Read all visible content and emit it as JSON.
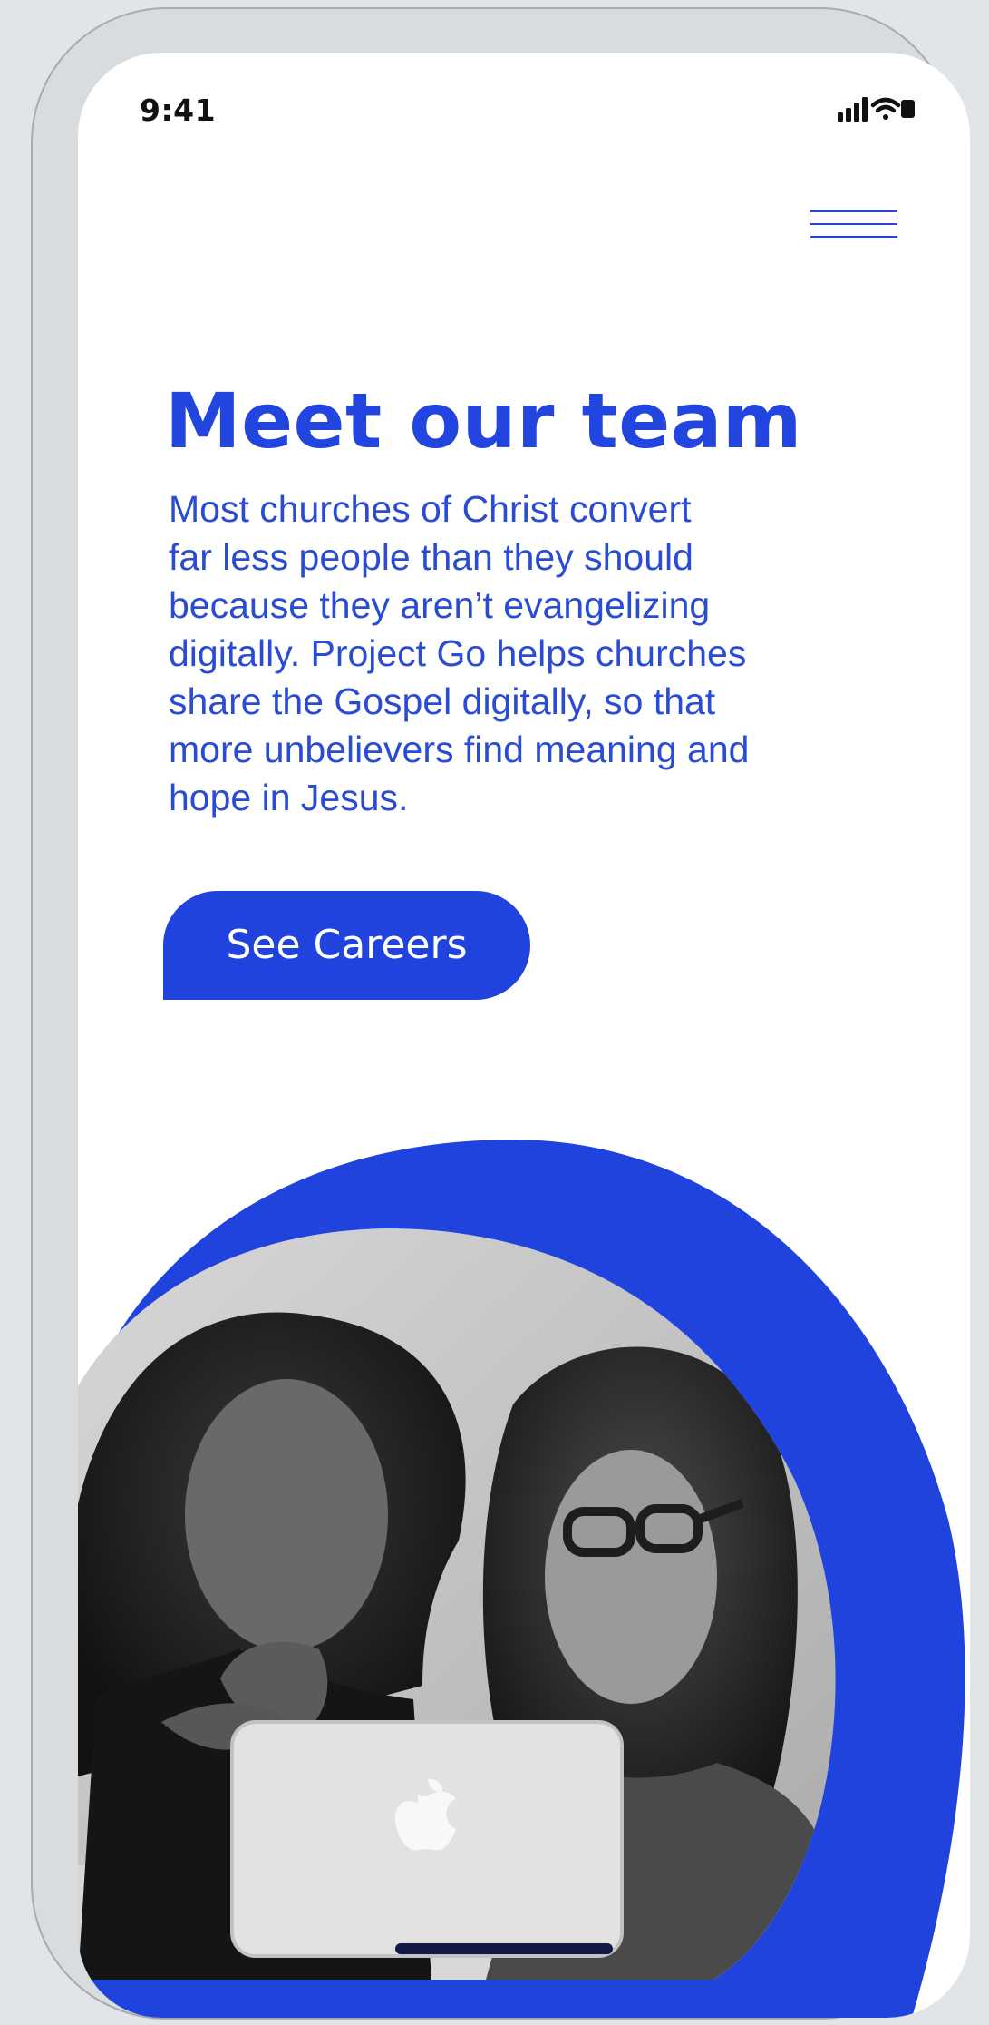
{
  "status_bar": {
    "time": "9:41",
    "icons": [
      "cellular-signal-icon",
      "wifi-icon",
      "battery-icon"
    ]
  },
  "header": {
    "menu_icon": "hamburger-menu-icon"
  },
  "hero": {
    "title": "Meet our team",
    "description": "Most churches of Christ convert\nfar less people than they should\nbecause they aren’t evangelizing\ndigitally. Project Go helps churches\nshare the Gospel digitally, so that\nmore unbelievers find meaning and\nhope in Jesus.",
    "cta_label": "See Careers"
  },
  "photo": {
    "subject": "two women looking at a laptop"
  },
  "colors": {
    "brand_blue": "#2043de",
    "text_blue": "#2a4bd3",
    "background": "#ffffff",
    "frame": "#e2e5e7"
  }
}
